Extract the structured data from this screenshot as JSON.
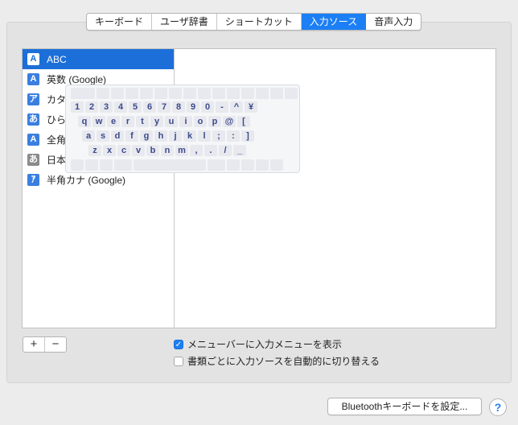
{
  "tabs": [
    {
      "label": "キーボード",
      "active": false
    },
    {
      "label": "ユーザ辞書",
      "active": false
    },
    {
      "label": "ショートカット",
      "active": false
    },
    {
      "label": "入力ソース",
      "active": true
    },
    {
      "label": "音声入力",
      "active": false
    }
  ],
  "sources": [
    {
      "icon": "A",
      "label": "ABC",
      "selected": true
    },
    {
      "icon": "A",
      "label": "英数 (Google)"
    },
    {
      "icon": "ア",
      "label": "カタカナ (Google)"
    },
    {
      "icon": "あ",
      "label": "ひらがな (Google)"
    },
    {
      "icon": "A",
      "label": "全角英数 (Google)"
    },
    {
      "icon": "あ",
      "label": "日本語"
    },
    {
      "icon": "ｱ",
      "label": "半角カナ (Google)"
    }
  ],
  "keyboard": {
    "row1": [
      "1",
      "2",
      "3",
      "4",
      "5",
      "6",
      "7",
      "8",
      "9",
      "0",
      "-",
      "^",
      "¥"
    ],
    "row2": [
      "q",
      "w",
      "e",
      "r",
      "t",
      "y",
      "u",
      "i",
      "o",
      "p",
      "@",
      "["
    ],
    "row3": [
      "a",
      "s",
      "d",
      "f",
      "g",
      "h",
      "j",
      "k",
      "l",
      ";",
      ":",
      "]"
    ],
    "row4": [
      "z",
      "x",
      "c",
      "v",
      "b",
      "n",
      "m",
      ",",
      ".",
      "/",
      "_"
    ]
  },
  "controls": {
    "add": "+",
    "remove": "−"
  },
  "options": {
    "show_menu": {
      "label": "メニューバーに入力メニューを表示",
      "checked": true
    },
    "auto_switch": {
      "label": "書類ごとに入力ソースを自動的に切り替える",
      "checked": false
    }
  },
  "bluetooth_button": "Bluetoothキーボードを設定...",
  "help_button": "?",
  "colors": {
    "accent": "#1c7ff5",
    "selection": "#1c6fd9"
  }
}
